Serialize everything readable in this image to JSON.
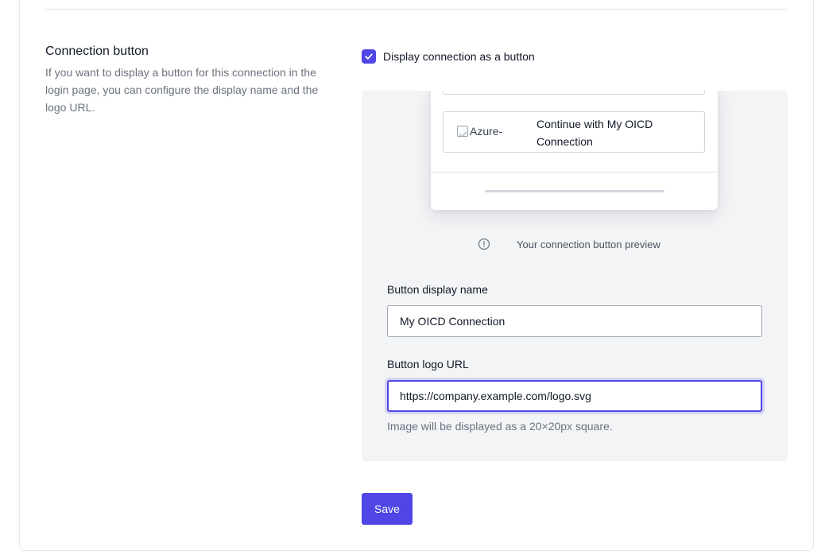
{
  "section": {
    "title": "Connection button",
    "description": "If you want to display a button for this connection in the login page, you can configure the display name and the logo URL."
  },
  "checkbox": {
    "label": "Display connection as a button",
    "checked": true
  },
  "preview": {
    "image_alt": "Azure-",
    "button_text": "Continue with My OICD Connection",
    "caption": "Your connection button preview"
  },
  "fields": {
    "display_name": {
      "label": "Button display name",
      "value": "My OICD Connection"
    },
    "logo_url": {
      "label": "Button logo URL",
      "value": "https://company.example.com/logo.svg",
      "hint": "Image will be displayed as a 20×20px square."
    }
  },
  "actions": {
    "save_label": "Save"
  },
  "colors": {
    "accent": "#4f46e5",
    "panel_bg": "#f3f4f6"
  }
}
